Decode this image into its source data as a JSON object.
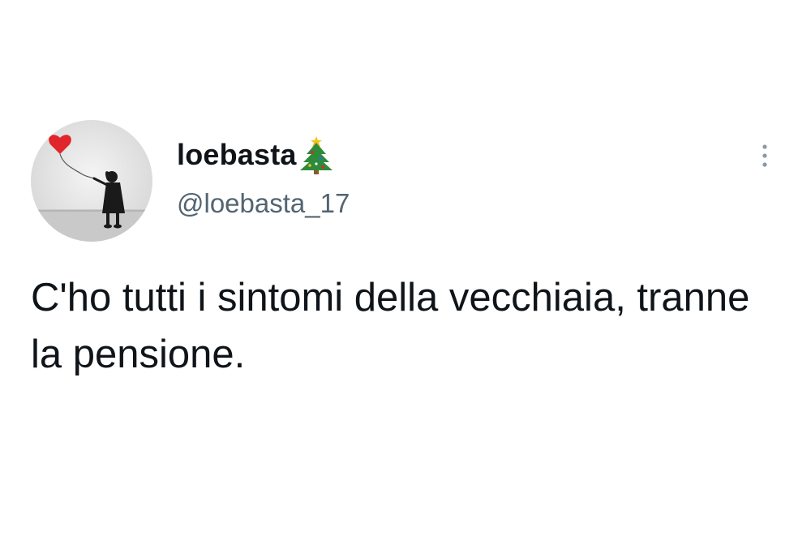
{
  "tweet": {
    "author": {
      "display_name": "loebasta",
      "name_emoji": "christmas-tree-icon",
      "handle": "@loebasta_17",
      "avatar": "girl-with-red-balloon-avatar"
    },
    "text": "C'ho tutti i sintomi della vecchiaia, tranne la pensione.",
    "more_icon": "more-vertical-icon"
  },
  "colors": {
    "text_primary": "#0f1419",
    "text_secondary": "#536471",
    "balloon_red": "#e0262a",
    "tree_green": "#2e8b3a"
  }
}
